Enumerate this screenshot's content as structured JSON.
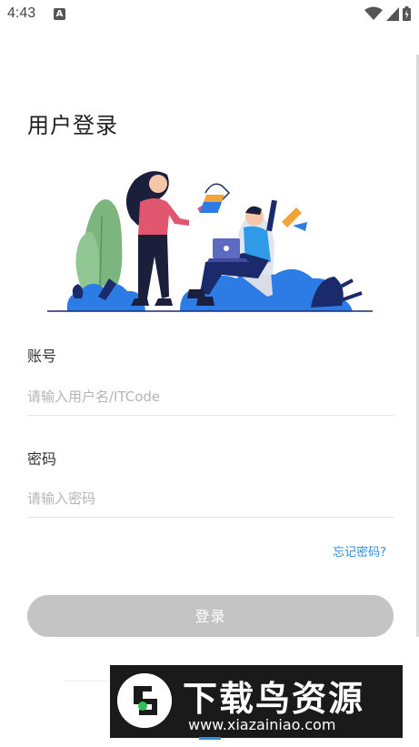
{
  "status_bar": {
    "time": "4:43",
    "notification_badge": "A",
    "icons": [
      "wifi-icon",
      "signal-icon",
      "battery-icon"
    ]
  },
  "page": {
    "title": "用户登录"
  },
  "form": {
    "account_label": "账号",
    "account_placeholder": "请输入用户名/ITCode",
    "password_label": "密码",
    "password_placeholder": "请输入密码",
    "forgot_link": "忘记密码?",
    "login_button": "登录"
  },
  "watermark": {
    "title": "下载鸟资源",
    "url": "www.xiazainiao.com"
  },
  "colors": {
    "accent": "#2f8fdc",
    "button_disabled": "#c4c4c4",
    "illustration_blue": "#2d7be5",
    "illustration_pink": "#e0566f",
    "illustration_green": "#7cb67e"
  }
}
